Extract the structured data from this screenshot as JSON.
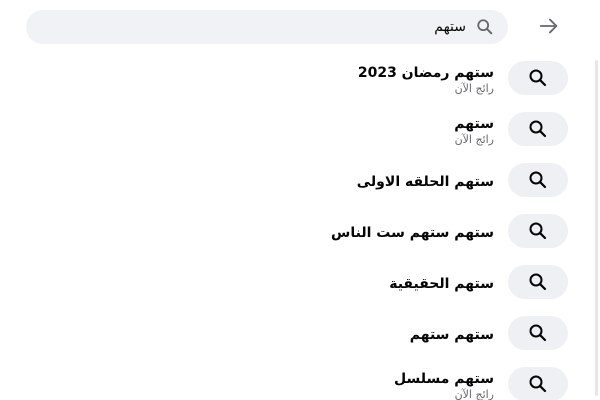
{
  "search": {
    "value": "ستهم"
  },
  "icons": {
    "back": "arrow-right-icon",
    "search": "search-icon"
  },
  "colors": {
    "search_bg": "#f0f2f5",
    "icon_circle_bg": "#eef0f3",
    "secondary_text": "#65676b"
  },
  "suggestions": [
    {
      "text": "ستهم رمضان 2023",
      "subtext": "رائج الآن"
    },
    {
      "text": "ستهم",
      "subtext": "رائج الآن"
    },
    {
      "text": "ستهم الحلقه الاولى",
      "subtext": ""
    },
    {
      "text": "ستهم ستهم ست الناس",
      "subtext": ""
    },
    {
      "text": "ستهم الحقيقية",
      "subtext": ""
    },
    {
      "text": "ستهم ستهم",
      "subtext": ""
    },
    {
      "text": "ستهم مسلسل",
      "subtext": "رائج الآن"
    }
  ]
}
